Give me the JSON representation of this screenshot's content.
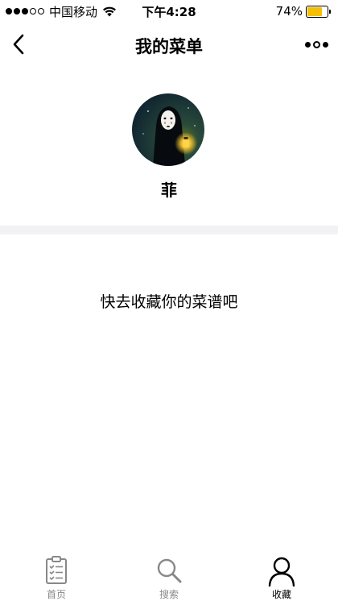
{
  "status_bar": {
    "carrier": "中国移动",
    "time": "下午4:28",
    "battery_percent": "74%",
    "battery_level": 0.74,
    "signal_bars_filled": 3,
    "signal_bars_total": 5,
    "battery_color": "#f5c000"
  },
  "nav": {
    "title": "我的菜单",
    "back_icon": "chevron-left-icon",
    "more_icon": "more-dots-icon"
  },
  "profile": {
    "name": "菲"
  },
  "empty_state": {
    "message": "快去收藏你的菜谱吧"
  },
  "tab_bar": {
    "tabs": [
      {
        "label": "首页",
        "icon": "clipboard-list-icon",
        "active": false
      },
      {
        "label": "搜索",
        "icon": "magnifier-icon",
        "active": false
      },
      {
        "label": "收藏",
        "icon": "person-icon",
        "active": true
      }
    ],
    "inactive_color": "#888888",
    "active_color": "#000000"
  }
}
